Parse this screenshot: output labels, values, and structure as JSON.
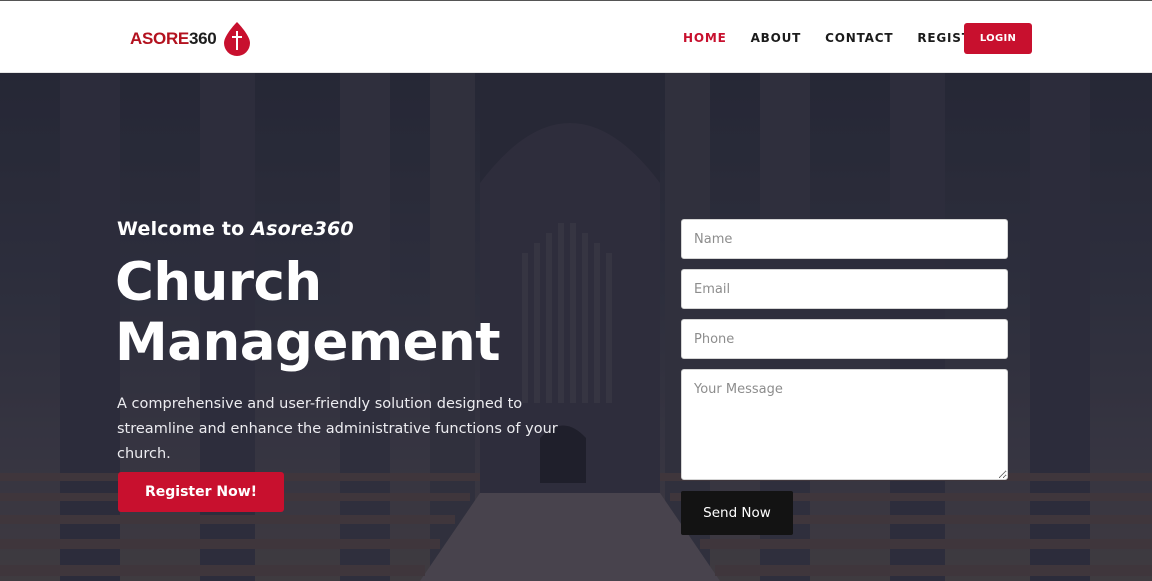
{
  "brand": {
    "part1": "ASORE",
    "part2": "360",
    "icon": "cross-drop-icon"
  },
  "nav": {
    "items": [
      {
        "label": "HOME",
        "active": true
      },
      {
        "label": "ABOUT",
        "active": false
      },
      {
        "label": "CONTACT",
        "active": false
      },
      {
        "label": "REGISTER",
        "active": false
      }
    ],
    "login_label": "LOGIN"
  },
  "hero": {
    "welcome_prefix": "Welcome to",
    "welcome_brand": "Asore360",
    "headline_line1": "Church",
    "headline_line2": "Management",
    "description": "A comprehensive and user-friendly solution designed to streamline and enhance the administrative functions of your church.",
    "cta_label": "Register Now!"
  },
  "form": {
    "name_placeholder": "Name",
    "email_placeholder": "Email",
    "phone_placeholder": "Phone",
    "message_placeholder": "Your Message",
    "submit_label": "Send Now"
  },
  "colors": {
    "accent": "#c8102e",
    "dark": "#131313",
    "brand_red": "#b3121f"
  }
}
